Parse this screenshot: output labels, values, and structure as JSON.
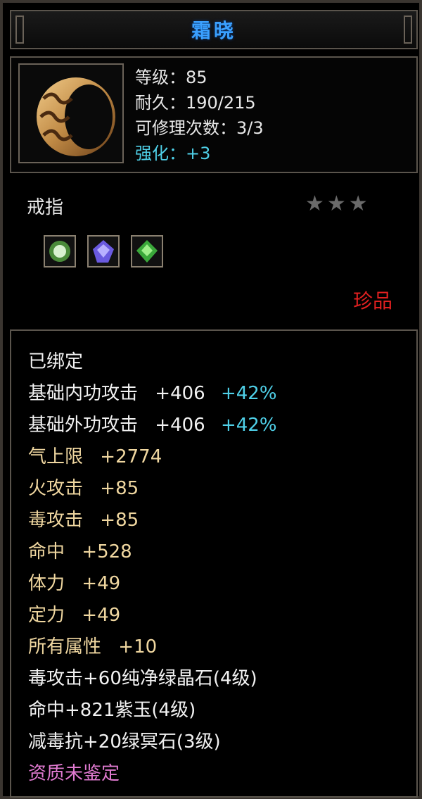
{
  "item": {
    "name": "霜晓",
    "level": "等级：85",
    "durability": "耐久：190/215",
    "repair": "可修理次数：3/3",
    "enhance": "强化：+3",
    "type": "戒指",
    "stars": "★★★",
    "rarity": "珍品"
  },
  "colors": {
    "title": "#3aa0ff",
    "rarity": "#e02020",
    "cyan": "#4fd0e8",
    "gold": "#f0d7a0",
    "pink": "#e07ad0"
  },
  "sockets": [
    {
      "icon": "green-white-gem-icon"
    },
    {
      "icon": "purple-gem-icon"
    },
    {
      "icon": "green-gem-icon"
    }
  ],
  "attributes": {
    "bound": "已绑定",
    "a1": {
      "label": "基础内功攻击",
      "value": "+406",
      "pct": "+42%"
    },
    "a2": {
      "label": "基础外功攻击",
      "value": "+406",
      "pct": "+42%"
    },
    "a3": {
      "label": "气上限",
      "value": "+2774"
    },
    "a4": {
      "label": "火攻击",
      "value": "+85"
    },
    "a5": {
      "label": "毒攻击",
      "value": "+85"
    },
    "a6": {
      "label": "命中",
      "value": "+528"
    },
    "a7": {
      "label": "体力",
      "value": "+49"
    },
    "a8": {
      "label": "定力",
      "value": "+49"
    },
    "a9": {
      "label": "所有属性",
      "value": "+10"
    },
    "g1": "毒攻击+60纯净绿晶石(4级)",
    "g2": "命中+821紫玉(4级)",
    "g3": "减毒抗+20绿冥石(3级)",
    "quality": "资质未鉴定"
  }
}
